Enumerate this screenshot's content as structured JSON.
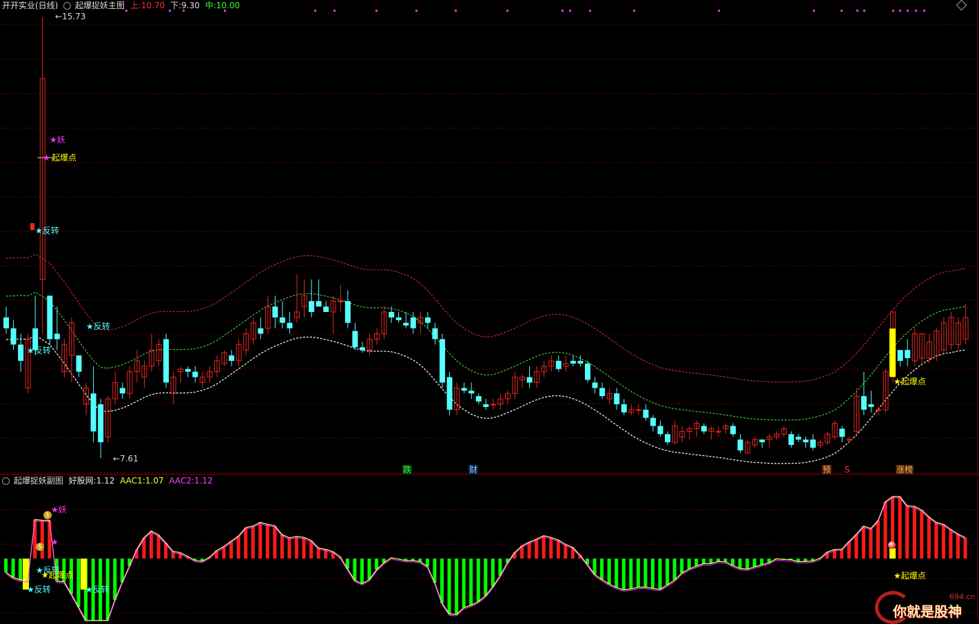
{
  "main_header": {
    "stock": "开开实业(日线)",
    "indicator": "起爆捉妖主图",
    "upper_label": "上:",
    "upper_value": "10.70",
    "lower_label": "下:",
    "lower_value": "9.30",
    "mid_label": "中:",
    "mid_value": "10.00"
  },
  "sub_header": {
    "indicator": "起爆捉妖副图",
    "f1_label": "好股网:",
    "f1_value": "1.12",
    "f2_label": "AAC1:",
    "f2_value": "1.07",
    "f3_label": "AAC2:",
    "f3_value": "1.12"
  },
  "annotations": {
    "high_price": "15.73",
    "low_price": "7.61",
    "star": "★",
    "yao": "妖",
    "qibaodian": "起爆点",
    "fanzhuan": "反转",
    "die": "跌",
    "cai": "财",
    "yu": "预",
    "s": "S",
    "zhangbang": "涨榜",
    "arrow_left": "←",
    "coin": "$"
  },
  "watermark": {
    "site": "694.cn",
    "slogan": "你就是股神"
  },
  "colors": {
    "up": "#e8271f",
    "down": "#54ffff",
    "grid": "#7a0000",
    "upper_band": "#c0282d",
    "mid_band": "#3fc53f",
    "lower_band": "#ffffff",
    "yellow": "#ffff00",
    "magenta": "#ff33ff",
    "green_hist": "#00ff00",
    "red_hist": "#ff1a1a"
  },
  "chart_data": {
    "type": "candlestick",
    "title": "起爆捉妖主图",
    "ohlc": [
      [
        10.2,
        10.4,
        9.9,
        10.0
      ],
      [
        10.0,
        10.15,
        9.6,
        9.7
      ],
      [
        9.7,
        9.9,
        9.2,
        9.4
      ],
      [
        8.9,
        9.9,
        8.8,
        9.8
      ],
      [
        10.0,
        10.6,
        9.5,
        9.6
      ],
      [
        10.9,
        15.73,
        9.9,
        14.6
      ],
      [
        10.6,
        10.4,
        9.7,
        9.8
      ],
      [
        9.9,
        10.4,
        9.6,
        9.8
      ],
      [
        9.2,
        9.8,
        9.1,
        9.7
      ],
      [
        9.5,
        10.2,
        9.0,
        10.1
      ],
      [
        9.5,
        9.5,
        9.1,
        9.2
      ],
      [
        8.6,
        9.0,
        8.4,
        8.9
      ],
      [
        8.8,
        9.3,
        7.9,
        8.1
      ],
      [
        8.6,
        8.7,
        7.61,
        7.9
      ],
      [
        8.0,
        8.75,
        7.9,
        8.7
      ],
      [
        8.7,
        9.2,
        8.6,
        9.0
      ],
      [
        8.9,
        9.0,
        8.7,
        8.8
      ],
      [
        8.8,
        9.3,
        8.7,
        9.2
      ],
      [
        9.2,
        9.6,
        9.0,
        9.4
      ],
      [
        9.1,
        9.4,
        8.9,
        9.3
      ],
      [
        9.3,
        9.9,
        9.2,
        9.6
      ],
      [
        9.4,
        9.8,
        9.3,
        9.7
      ],
      [
        9.8,
        9.9,
        8.9,
        9.0
      ],
      [
        8.8,
        9.2,
        8.6,
        9.1
      ],
      [
        9.2,
        9.3,
        9.0,
        9.25
      ],
      [
        9.25,
        9.3,
        9.1,
        9.2
      ],
      [
        9.2,
        9.3,
        9.0,
        9.1
      ],
      [
        9.0,
        9.2,
        8.9,
        9.1
      ],
      [
        9.1,
        9.3,
        9.0,
        9.2
      ],
      [
        9.2,
        9.5,
        9.1,
        9.4
      ],
      [
        9.35,
        9.6,
        9.3,
        9.55
      ],
      [
        9.5,
        9.6,
        9.3,
        9.4
      ],
      [
        9.4,
        9.8,
        9.3,
        9.7
      ],
      [
        9.6,
        10.0,
        9.5,
        9.9
      ],
      [
        9.8,
        10.2,
        9.7,
        10.1
      ],
      [
        10.0,
        10.2,
        9.8,
        9.9
      ],
      [
        10.0,
        10.6,
        9.9,
        10.4
      ],
      [
        10.4,
        10.6,
        10.0,
        10.2
      ],
      [
        10.2,
        10.5,
        10.0,
        10.1
      ],
      [
        10.1,
        10.3,
        9.9,
        10.0
      ],
      [
        10.2,
        11.0,
        10.1,
        10.3
      ],
      [
        10.4,
        10.9,
        10.2,
        10.6
      ],
      [
        10.5,
        10.9,
        10.2,
        10.3
      ],
      [
        10.5,
        10.9,
        10.4,
        10.4
      ],
      [
        10.4,
        10.5,
        10.3,
        10.3
      ],
      [
        10.3,
        10.6,
        9.9,
        10.5
      ],
      [
        10.5,
        10.8,
        10.3,
        10.5
      ],
      [
        10.5,
        10.7,
        10.0,
        10.1
      ],
      [
        9.95,
        10.1,
        9.6,
        9.65
      ],
      [
        9.65,
        9.75,
        9.55,
        9.6
      ],
      [
        9.6,
        9.9,
        9.5,
        9.8
      ],
      [
        9.8,
        10.0,
        9.7,
        9.9
      ],
      [
        9.9,
        10.4,
        9.8,
        10.3
      ],
      [
        10.3,
        10.4,
        10.1,
        10.2
      ],
      [
        10.2,
        10.3,
        10.1,
        10.15
      ],
      [
        10.1,
        10.3,
        10.0,
        10.05
      ],
      [
        10.2,
        10.3,
        9.9,
        10.0
      ],
      [
        10.1,
        10.3,
        9.9,
        10.2
      ],
      [
        10.2,
        10.3,
        10.0,
        10.1
      ],
      [
        10.0,
        10.1,
        9.7,
        9.8
      ],
      [
        9.8,
        9.9,
        8.9,
        9.0
      ],
      [
        9.1,
        9.2,
        8.4,
        8.5
      ],
      [
        8.5,
        9.0,
        8.4,
        8.9
      ],
      [
        8.9,
        9.0,
        8.8,
        8.85
      ],
      [
        8.85,
        9.0,
        8.7,
        8.8
      ],
      [
        8.75,
        8.8,
        8.6,
        8.65
      ],
      [
        8.6,
        8.7,
        8.5,
        8.55
      ],
      [
        8.6,
        8.7,
        8.5,
        8.6
      ],
      [
        8.6,
        8.8,
        8.5,
        8.7
      ],
      [
        8.7,
        8.85,
        8.6,
        8.8
      ],
      [
        8.8,
        9.2,
        8.7,
        9.1
      ],
      [
        9.05,
        9.15,
        8.9,
        9.1
      ],
      [
        9.1,
        9.3,
        8.9,
        9.0
      ],
      [
        9.0,
        9.3,
        8.9,
        9.2
      ],
      [
        9.2,
        9.4,
        9.1,
        9.3
      ],
      [
        9.3,
        9.5,
        9.2,
        9.4
      ],
      [
        9.4,
        9.5,
        9.2,
        9.25
      ],
      [
        9.3,
        9.5,
        9.2,
        9.35
      ],
      [
        9.4,
        9.5,
        9.3,
        9.35
      ],
      [
        9.4,
        9.5,
        9.3,
        9.35
      ],
      [
        9.35,
        9.4,
        9.0,
        9.05
      ],
      [
        9.0,
        9.1,
        8.8,
        8.9
      ],
      [
        8.9,
        9.0,
        8.7,
        8.75
      ],
      [
        8.7,
        8.9,
        8.6,
        8.8
      ],
      [
        8.8,
        8.9,
        8.5,
        8.6
      ],
      [
        8.6,
        8.7,
        8.4,
        8.45
      ],
      [
        8.45,
        8.6,
        8.4,
        8.5
      ],
      [
        8.5,
        8.6,
        8.4,
        8.5
      ],
      [
        8.5,
        8.6,
        8.3,
        8.35
      ],
      [
        8.35,
        8.4,
        8.1,
        8.2
      ],
      [
        8.2,
        8.3,
        8.0,
        8.05
      ],
      [
        8.05,
        8.1,
        7.85,
        7.9
      ],
      [
        7.9,
        8.3,
        7.85,
        8.2
      ],
      [
        8.0,
        8.2,
        7.9,
        8.1
      ],
      [
        8.1,
        8.2,
        7.95,
        8.15
      ],
      [
        8.15,
        8.3,
        8.0,
        8.25
      ],
      [
        8.2,
        8.25,
        8.05,
        8.1
      ],
      [
        8.1,
        8.2,
        7.95,
        8.15
      ],
      [
        8.1,
        8.2,
        8.0,
        8.1
      ],
      [
        8.15,
        8.25,
        8.05,
        8.2
      ],
      [
        8.2,
        8.25,
        8.0,
        8.05
      ],
      [
        7.95,
        8.05,
        7.7,
        7.75
      ],
      [
        7.7,
        7.95,
        7.7,
        7.9
      ],
      [
        7.85,
        8.0,
        7.8,
        7.95
      ],
      [
        7.95,
        7.95,
        7.8,
        7.9
      ],
      [
        7.95,
        8.05,
        7.8,
        8.0
      ],
      [
        8.0,
        8.1,
        7.95,
        8.05
      ],
      [
        8.05,
        8.2,
        8.0,
        8.15
      ],
      [
        8.05,
        8.1,
        7.8,
        7.85
      ],
      [
        8.0,
        8.05,
        7.9,
        7.95
      ],
      [
        7.95,
        8.0,
        7.8,
        7.9
      ],
      [
        7.95,
        8.05,
        7.75,
        7.8
      ],
      [
        7.85,
        7.95,
        7.8,
        7.9
      ],
      [
        7.9,
        8.1,
        7.85,
        8.05
      ],
      [
        8.0,
        8.3,
        7.95,
        8.25
      ],
      [
        8.15,
        8.2,
        7.9,
        8.0
      ],
      [
        7.95,
        8.0,
        7.9,
        7.95
      ],
      [
        8.1,
        8.9,
        8.0,
        8.75
      ],
      [
        8.75,
        9.2,
        8.4,
        8.5
      ],
      [
        8.6,
        8.85,
        8.45,
        8.55
      ],
      [
        8.5,
        8.55,
        8.4,
        8.5
      ],
      [
        8.5,
        9.25,
        8.45,
        9.2
      ],
      [
        9.1,
        10.3,
        9.0,
        10.3
      ],
      [
        9.6,
        9.6,
        9.3,
        9.4
      ],
      [
        9.6,
        9.8,
        9.3,
        9.45
      ],
      [
        9.4,
        10.0,
        9.3,
        9.9
      ],
      [
        9.45,
        9.9,
        9.3,
        9.9
      ],
      [
        9.45,
        9.9,
        9.35,
        9.75
      ],
      [
        9.5,
        10.0,
        9.4,
        9.95
      ],
      [
        9.6,
        10.2,
        9.5,
        10.1
      ],
      [
        9.7,
        10.3,
        9.6,
        10.2
      ],
      [
        9.7,
        10.2,
        9.6,
        10.1
      ],
      [
        9.8,
        10.45,
        9.7,
        10.2
      ]
    ],
    "price_range": [
      7.4,
      16.0
    ]
  }
}
